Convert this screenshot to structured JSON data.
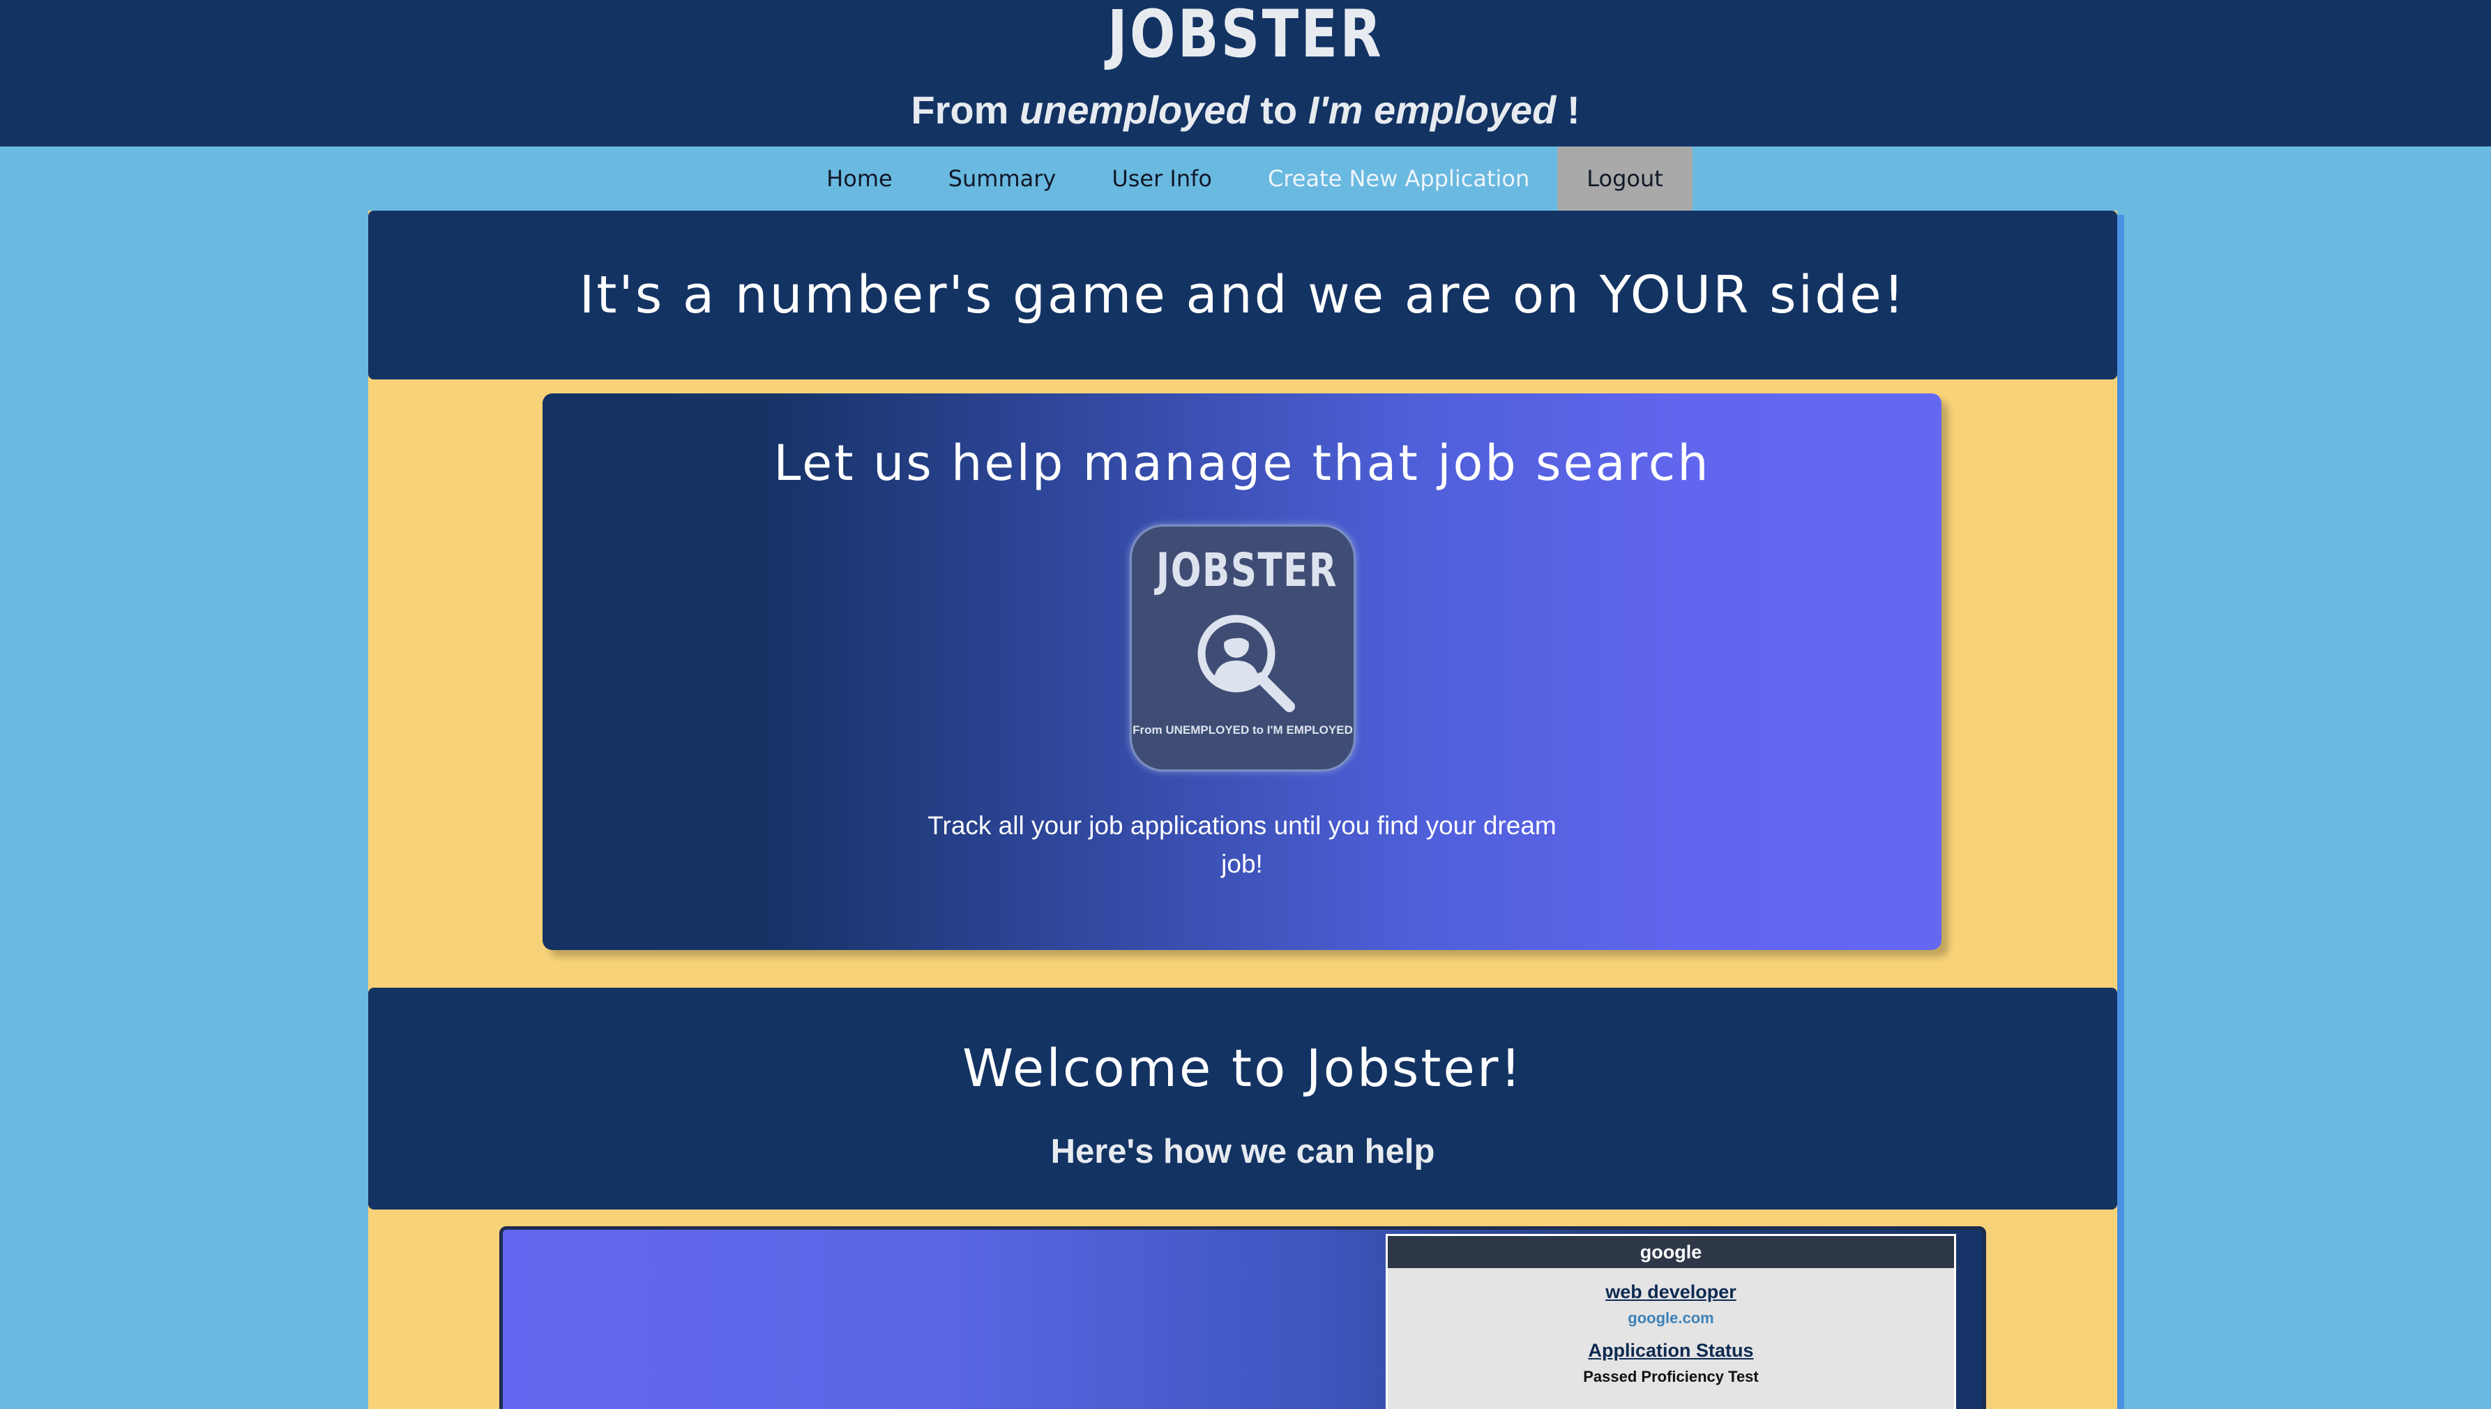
{
  "header": {
    "brand": "JOBSTER",
    "tagline": {
      "part1": "From ",
      "em1": "unemployed",
      "part2": " to ",
      "em2": "I'm employed",
      "part3": " !"
    }
  },
  "nav": {
    "items": [
      {
        "label": "Home"
      },
      {
        "label": "Summary"
      },
      {
        "label": "User Info"
      },
      {
        "label": "Create New Application"
      },
      {
        "label": "Logout"
      }
    ],
    "active_index": 3
  },
  "banner": {
    "heading": "It's a number's game and we are on YOUR side!"
  },
  "hero": {
    "heading": "Let us help manage that job search",
    "logo": {
      "word": "JOBSTER",
      "caption": "From UNEMPLOYED to I'M EMPLOYED",
      "icon": "magnifier-person-icon"
    },
    "description": "Track all your job applications until you find your dream job!"
  },
  "welcome": {
    "heading": "Welcome to Jobster!",
    "subheading": "Here's how we can help"
  },
  "demo_card": {
    "company": "google",
    "position": "web developer",
    "website": "google.com",
    "status_label": "Application Status",
    "status": "Passed Proficiency Test"
  },
  "colors": {
    "navy": "#133363",
    "sky": "#69b9e0",
    "yellow": "#f7d278",
    "violet": "#6468f0",
    "logout_bg": "#a9a9a9"
  }
}
